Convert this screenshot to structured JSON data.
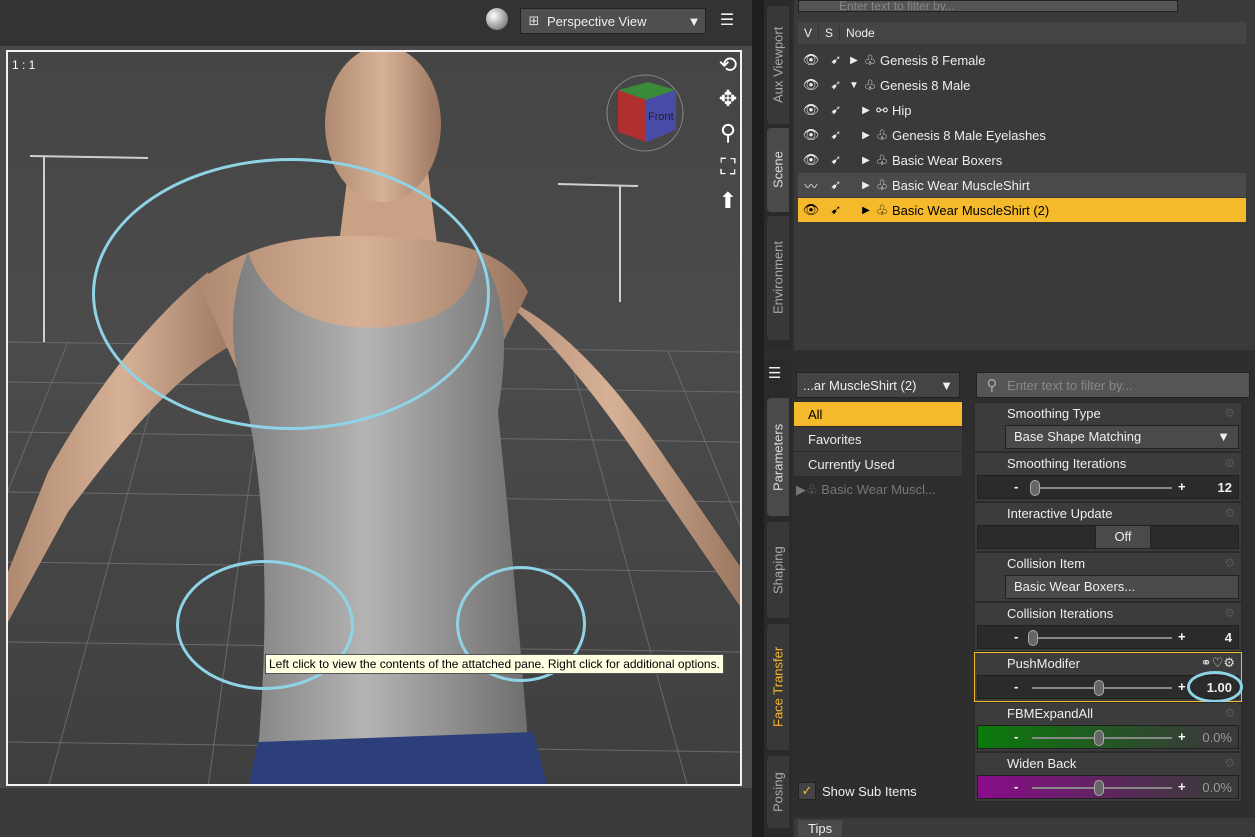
{
  "viewport": {
    "ratio": "1 : 1",
    "view_select": "Perspective View",
    "tooltip": "Left click to view the contents of the attatched pane. Right click for additional options.",
    "cube_label": "Front"
  },
  "vtabs_top": [
    "Aux Viewport",
    "Scene",
    "Environment"
  ],
  "vtabs_bottom": [
    "Parameters",
    "Shaping",
    "Face Transfer",
    "Posing"
  ],
  "scene": {
    "filter_placeholder": "Enter text to filter by...",
    "header": {
      "v": "V",
      "s": "S",
      "node": "Node"
    },
    "rows": [
      {
        "label": "Genesis 8 Female",
        "indent": 0,
        "state": "normal"
      },
      {
        "label": "Genesis 8 Male",
        "indent": 0,
        "state": "normal"
      },
      {
        "label": "Hip",
        "indent": 1,
        "state": "normal"
      },
      {
        "label": "Genesis 8 Male Eyelashes",
        "indent": 1,
        "state": "normal"
      },
      {
        "label": "Basic Wear Boxers",
        "indent": 1,
        "state": "normal"
      },
      {
        "label": "Basic Wear MuscleShirt",
        "indent": 1,
        "state": "dim"
      },
      {
        "label": "Basic Wear MuscleShirt (2)",
        "indent": 1,
        "state": "selected"
      }
    ]
  },
  "params": {
    "node_select": "...ar MuscleShirt (2)",
    "filter_placeholder": "Enter text to filter by...",
    "categories": [
      "All",
      "Favorites",
      "Currently Used"
    ],
    "tree_item": "Basic Wear Muscl...",
    "show_sub_items": "Show Sub Items",
    "smoothing_type": {
      "label": "Smoothing Type",
      "value": "Base Shape Matching"
    },
    "smoothing_iterations": {
      "label": "Smoothing Iterations",
      "value": "12"
    },
    "interactive_update": {
      "label": "Interactive Update",
      "value": "Off"
    },
    "collision_item": {
      "label": "Collision Item",
      "value": "Basic Wear Boxers..."
    },
    "collision_iterations": {
      "label": "Collision Iterations",
      "value": "4"
    },
    "push_modifier": {
      "label": "PushModifer",
      "value": "1.00"
    },
    "fbm_expand": {
      "label": "FBMExpandAll",
      "value": "0.0%"
    },
    "widen_back": {
      "label": "Widen Back",
      "value": "0.0%"
    },
    "tips": "Tips"
  },
  "colors": {
    "accent": "#f5b92c",
    "highlight": "#8fd3e6"
  }
}
